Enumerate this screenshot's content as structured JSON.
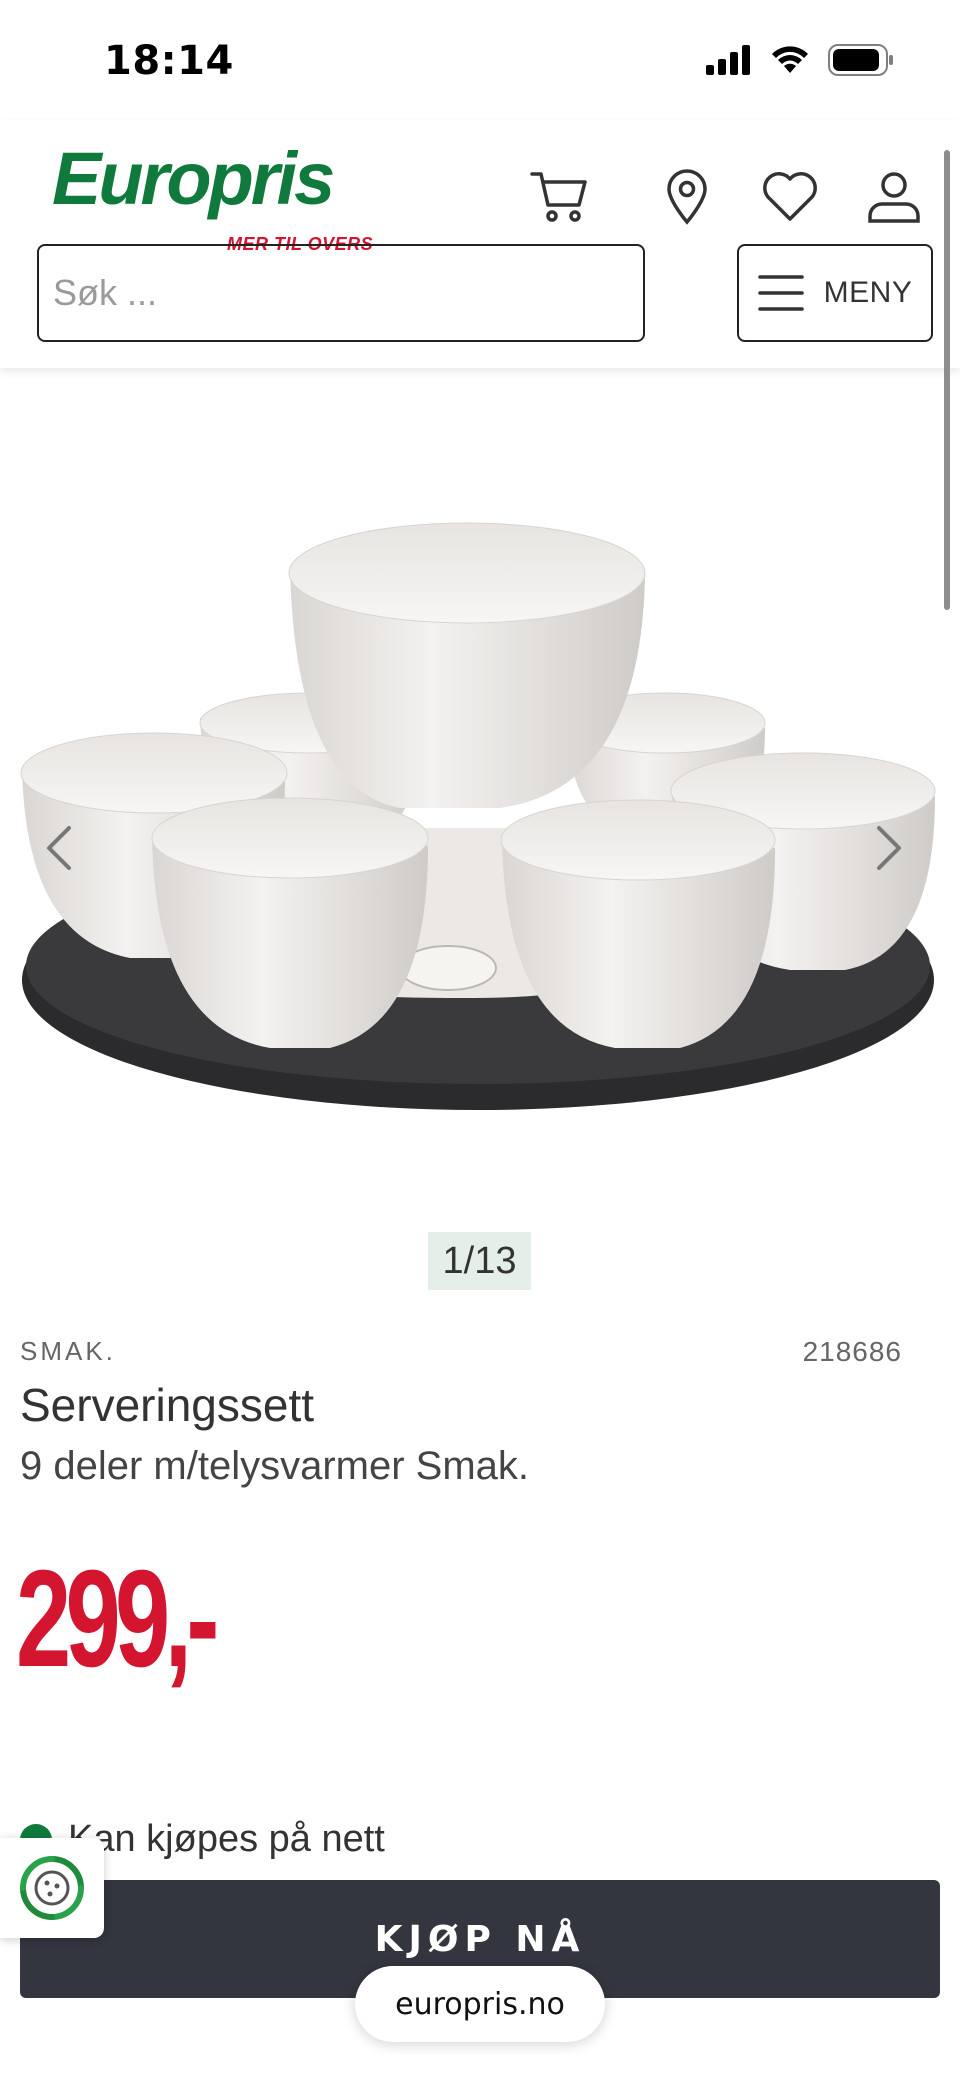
{
  "status_bar": {
    "time": "18:14",
    "icons": [
      "signal-icon",
      "wifi-icon",
      "battery-icon"
    ]
  },
  "header": {
    "logo_text": "Europris",
    "logo_tagline": "MER TIL OVERS",
    "icons": [
      "cart-icon",
      "location-pin-icon",
      "heart-icon",
      "user-icon"
    ],
    "search_placeholder": "Søk ...",
    "menu_label": "MENY"
  },
  "gallery": {
    "counter": "1/13",
    "prev_icon": "chevron-left-icon",
    "next_icon": "chevron-right-icon"
  },
  "product": {
    "brand": "SMAK.",
    "sku": "218686",
    "title": "Serveringssett",
    "subtitle": "9 deler m/telysvarmer Smak.",
    "price": "299,-",
    "availability": "Kan kjøpes på nett",
    "buy_label": "KJØP NÅ"
  },
  "browser": {
    "url": "europris.no"
  },
  "colors": {
    "brand_green": "#0f7a3b",
    "price_red": "#d4152f",
    "button_dark": "#33353f",
    "counter_bg": "#e5efe9"
  }
}
